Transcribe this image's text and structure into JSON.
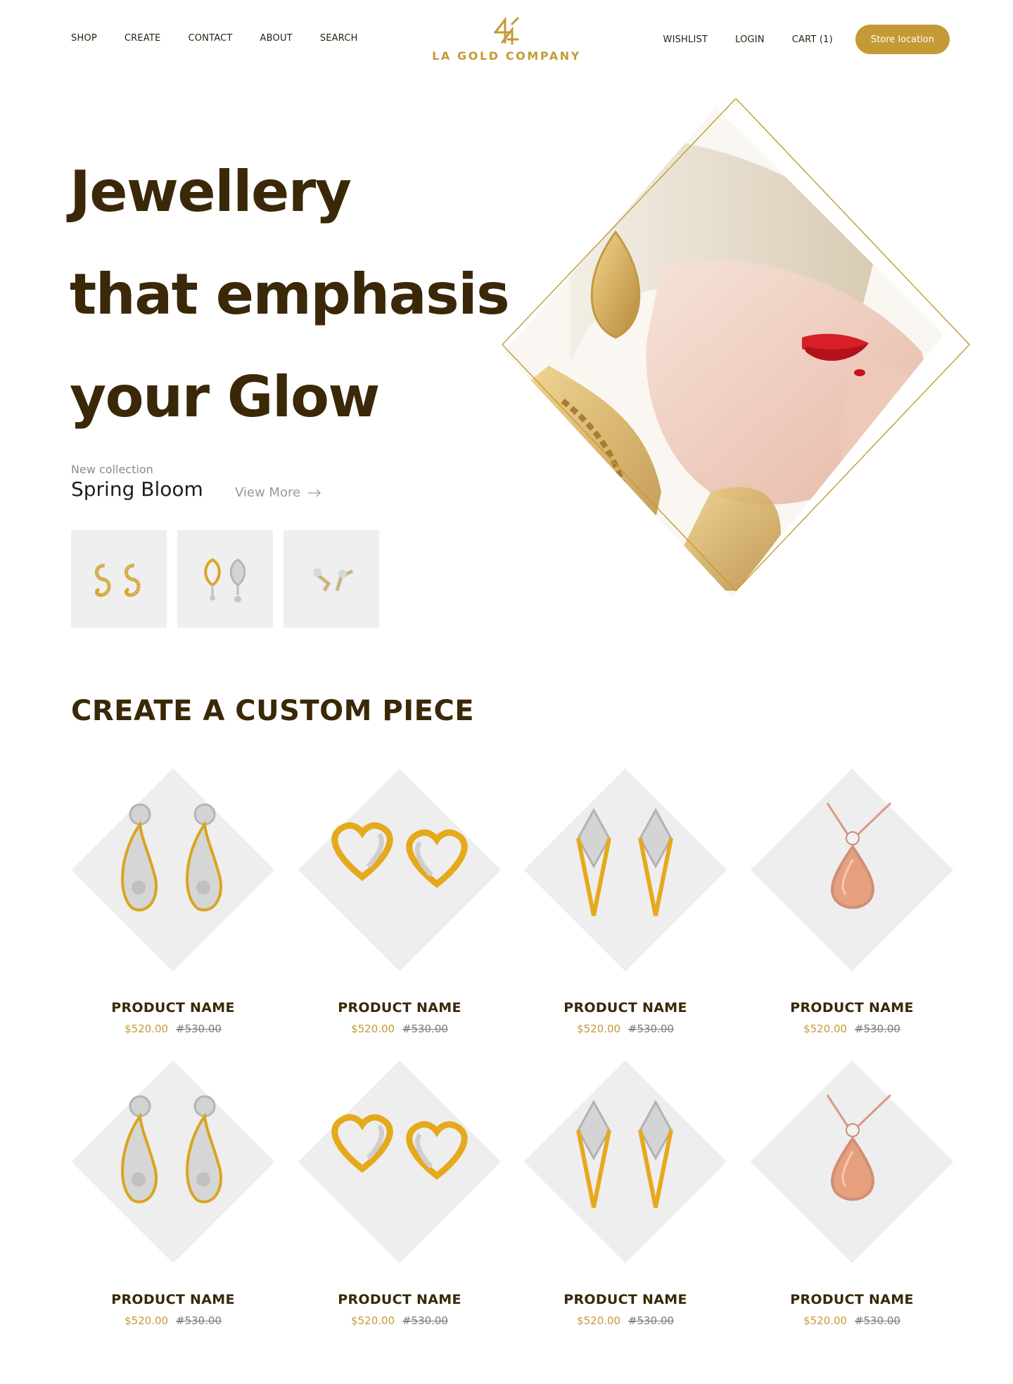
{
  "nav": {
    "left": [
      "SHOP",
      "CREATE",
      "CONTACT",
      "ABOUT",
      "SEARCH"
    ],
    "right": [
      "WISHLIST",
      "LOGIN",
      "CART (1)"
    ],
    "store_button": "Store location",
    "logo_text": "LA GOLD COMPANY"
  },
  "hero": {
    "title_lines": [
      "Jewellery",
      "that emphasis",
      "your Glow"
    ],
    "collection_kicker": "New collection",
    "collection_name": "Spring Bloom",
    "view_more": "View More"
  },
  "section": {
    "title": "CREATE A CUSTOM PIECE"
  },
  "products": [
    {
      "name": "PRODUCT NAME",
      "price": "$520.00",
      "old_price": "#530.00",
      "icon": "drop-earrings"
    },
    {
      "name": "PRODUCT NAME",
      "price": "$520.00",
      "old_price": "#530.00",
      "icon": "heart-earrings"
    },
    {
      "name": "PRODUCT NAME",
      "price": "$520.00",
      "old_price": "#530.00",
      "icon": "diamond-earrings"
    },
    {
      "name": "PRODUCT NAME",
      "price": "$520.00",
      "old_price": "#530.00",
      "icon": "pendant-necklace"
    },
    {
      "name": "PRODUCT NAME",
      "price": "$520.00",
      "old_price": "#530.00",
      "icon": "drop-earrings"
    },
    {
      "name": "PRODUCT NAME",
      "price": "$520.00",
      "old_price": "#530.00",
      "icon": "heart-earrings"
    },
    {
      "name": "PRODUCT NAME",
      "price": "$520.00",
      "old_price": "#530.00",
      "icon": "diamond-earrings"
    },
    {
      "name": "PRODUCT NAME",
      "price": "$520.00",
      "old_price": "#530.00",
      "icon": "pendant-necklace"
    }
  ],
  "colors": {
    "accent": "#c49a35",
    "heading": "#3a2808",
    "tile": "#eeeeee"
  }
}
